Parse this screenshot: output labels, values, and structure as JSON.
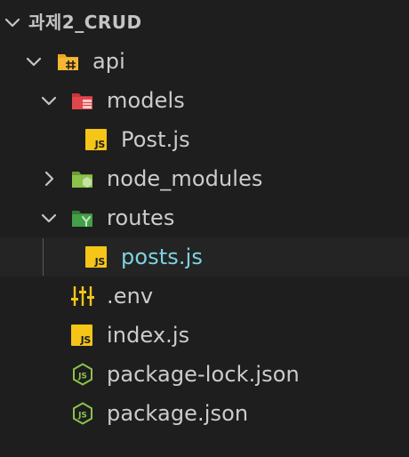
{
  "explorer": {
    "root": {
      "label": "과제2_CRUD",
      "expanded": true
    },
    "items": [
      {
        "label": "api",
        "type": "folder",
        "expanded": true,
        "icon": "folder-api-icon",
        "color": "#e8a825"
      },
      {
        "label": "models",
        "type": "folder",
        "expanded": true,
        "icon": "folder-models-icon",
        "color": "#e0474c"
      },
      {
        "label": "Post.js",
        "type": "file",
        "icon": "javascript-file-icon"
      },
      {
        "label": "node_modules",
        "type": "folder",
        "expanded": false,
        "icon": "folder-node-icon",
        "color": "#8bc34a"
      },
      {
        "label": "routes",
        "type": "folder",
        "expanded": true,
        "icon": "folder-routes-icon",
        "color": "#43a047"
      },
      {
        "label": "posts.js",
        "type": "file",
        "icon": "javascript-file-icon",
        "selected": true
      },
      {
        "label": ".env",
        "type": "file",
        "icon": "tune-icon"
      },
      {
        "label": "index.js",
        "type": "file",
        "icon": "javascript-file-icon"
      },
      {
        "label": "package-lock.json",
        "type": "file",
        "icon": "nodejs-icon"
      },
      {
        "label": "package.json",
        "type": "file",
        "icon": "nodejs-icon"
      }
    ],
    "js_badge_text": "JS",
    "colors": {
      "background": "#1e1e1e",
      "selected_background": "#242424",
      "text": "#cccccc",
      "active_text": "#7fd3e0",
      "js_yellow": "#f5c518",
      "node_green": "#8bc34a"
    }
  }
}
